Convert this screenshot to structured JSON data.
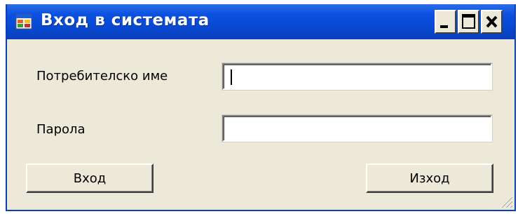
{
  "window": {
    "title": "Вход в системата",
    "icon": "app-window-icon",
    "controls": {
      "minimize": "minimize-icon",
      "maximize": "maximize-icon",
      "close": "close-icon"
    }
  },
  "form": {
    "username_label": "Потребителско име",
    "username_value": "",
    "password_label": "Парола",
    "password_value": "",
    "login_button": "Вход",
    "exit_button": "Изход"
  },
  "colors": {
    "titlebar": "#0a50e0",
    "window_bg": "#ece9d8",
    "title_text": "#ffffff"
  }
}
